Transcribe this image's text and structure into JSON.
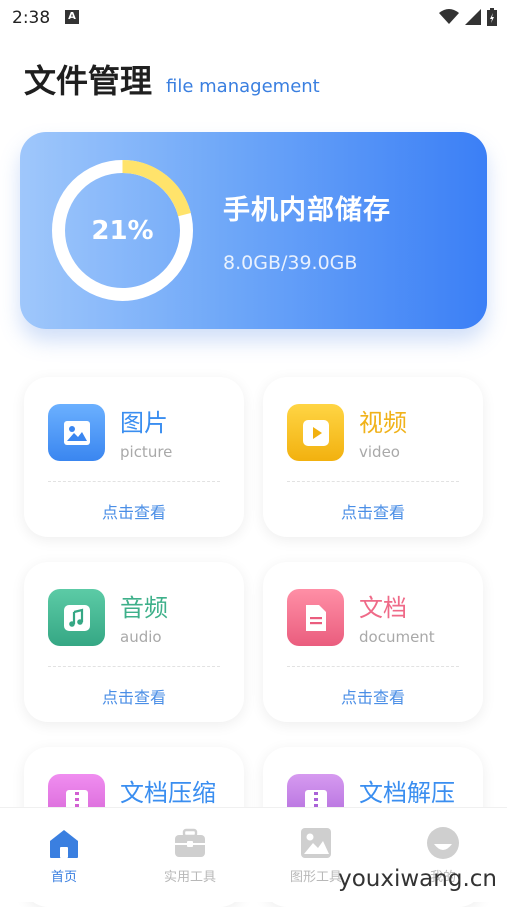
{
  "status_bar": {
    "time": "2:38",
    "notif_icon": "a-letter-icon"
  },
  "header": {
    "title": "文件管理",
    "subtitle": "file management"
  },
  "storage": {
    "percent_label": "21%",
    "percent_value": 0.21,
    "title": "手机内部储存",
    "size": "8.0GB/39.0GB",
    "ring_color": "#ffe36b"
  },
  "tiles": [
    {
      "name": "图片",
      "en": "picture",
      "action": "点击查看",
      "color": "#3a8ef0",
      "icon": "image-icon"
    },
    {
      "name": "视频",
      "en": "video",
      "action": "点击查看",
      "color": "#f0b21a",
      "icon": "play-icon"
    },
    {
      "name": "音频",
      "en": "audio",
      "action": "点击查看",
      "color": "#3eb08a",
      "icon": "music-note-icon"
    },
    {
      "name": "文档",
      "en": "document",
      "action": "点击查看",
      "color": "#ef6a88",
      "icon": "document-icon"
    },
    {
      "name": "文档压缩",
      "en": "",
      "action": "",
      "color": "#d86bd8",
      "icon": "zip-icon"
    },
    {
      "name": "文档解压",
      "en": "",
      "action": "",
      "color": "#b06bd8",
      "icon": "unzip-icon"
    }
  ],
  "nav": [
    {
      "label": "首页",
      "icon": "home-icon",
      "active": true
    },
    {
      "label": "实用工具",
      "icon": "toolbox-icon",
      "active": false
    },
    {
      "label": "图形工具",
      "icon": "image-tool-icon",
      "active": false
    },
    {
      "label": "我的",
      "icon": "profile-icon",
      "active": false
    }
  ],
  "watermark": "youxiwang.cn",
  "colors": {
    "accent": "#3a7fe0",
    "nav_active": "#3a7fe0",
    "nav_inactive": "#b8b8b8"
  }
}
